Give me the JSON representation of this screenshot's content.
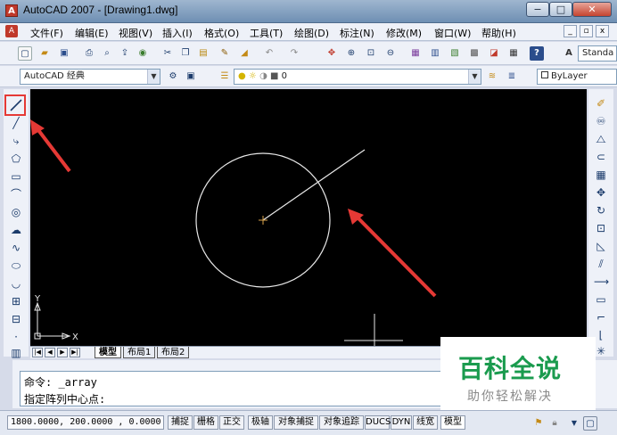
{
  "window": {
    "title": "AutoCAD 2007 - [Drawing1.dwg]",
    "icon_letter": "A",
    "minimize": "−",
    "maximize": "□",
    "close": "✕"
  },
  "menu": {
    "items": [
      "文件(F)",
      "编辑(E)",
      "视图(V)",
      "插入(I)",
      "格式(O)",
      "工具(T)",
      "绘图(D)",
      "标注(N)",
      "修改(M)",
      "窗口(W)",
      "帮助(H)"
    ],
    "doc_min": "_",
    "doc_restore": "▫",
    "doc_close": "x"
  },
  "toolbar1": {
    "style_dropdown": "Standa"
  },
  "toolbar2": {
    "workspace": "AutoCAD 经典",
    "layer": "0",
    "bylayer": "ByLayer"
  },
  "layout_tabs": {
    "nav": [
      "|◀",
      "◀",
      "▶",
      "▶|"
    ],
    "tabs": [
      "模型",
      "布局1",
      "布局2"
    ]
  },
  "canvas": {
    "ucs_y": "Y",
    "ucs_x": "X",
    "background": "#000000",
    "entity_color": "#e8e8e8",
    "center_mark_color": "#d9a24a",
    "arrow_color": "#e53935"
  },
  "command": {
    "line1": "命令: _array",
    "line2": "指定阵列中心点:"
  },
  "status": {
    "coords": "1800.0000, 200.0000 , 0.0000",
    "buttons": [
      "捕捉",
      "栅格",
      "正交",
      "极轴",
      "对象捕捉",
      "对象追踪",
      "DUCS",
      "DYN",
      "线宽",
      "模型"
    ]
  },
  "watermark": {
    "title": "百科全说",
    "subtitle": "助你轻松解决"
  }
}
